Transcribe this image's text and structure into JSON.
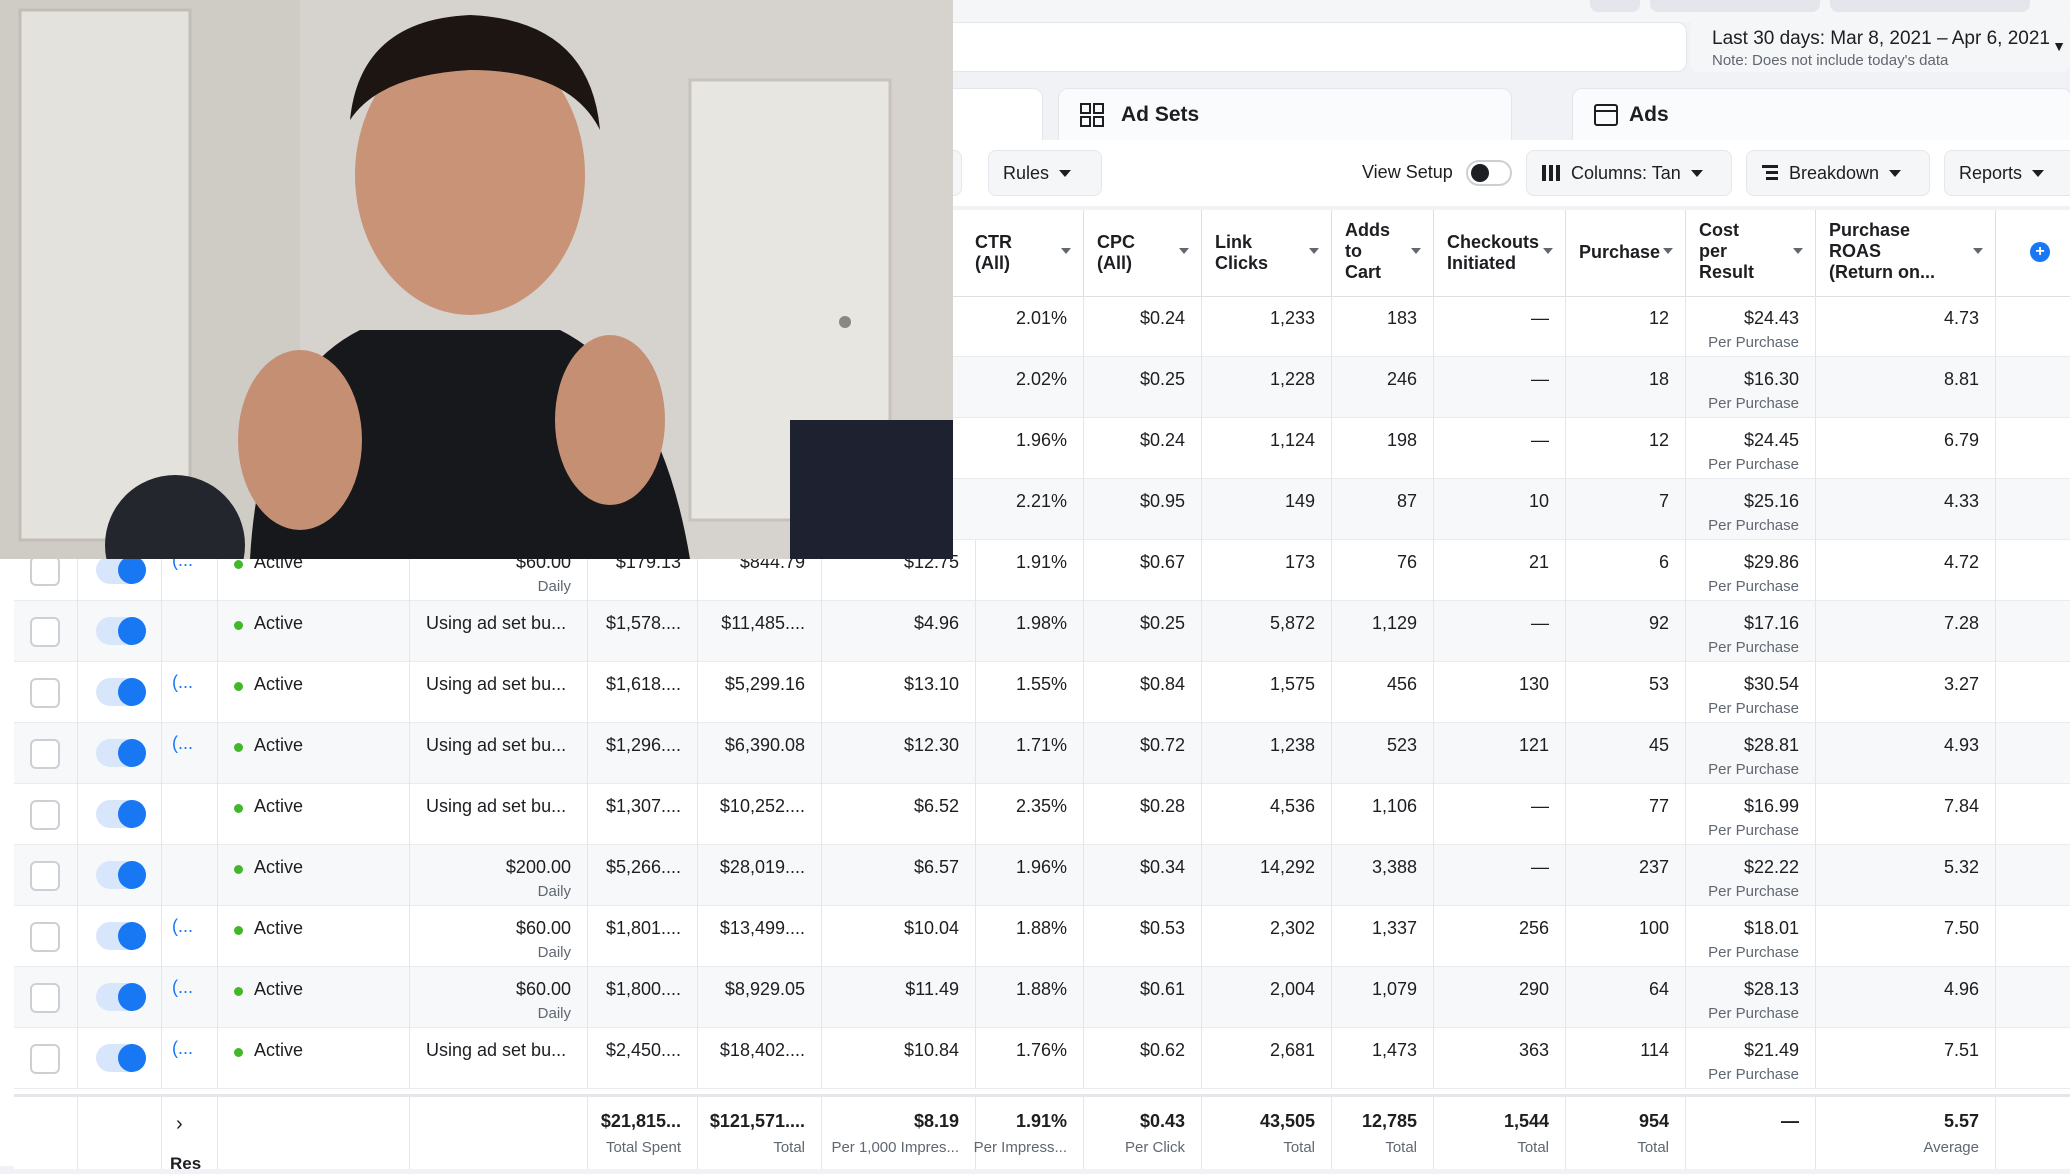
{
  "date_range": {
    "label": "Last 30 days: Mar 8, 2021 – Apr 6, 2021",
    "note": "Note: Does not include today's data"
  },
  "tabs": [
    {
      "label": "Ad Sets",
      "icon": "grid-icon"
    },
    {
      "label": "Ads",
      "icon": "ad-preview-icon"
    }
  ],
  "toolbar": {
    "rules_label": "Rules",
    "view_setup_label": "View Setup",
    "columns_label": "Columns: Tan",
    "breakdown_label": "Breakdown",
    "reports_label": "Reports"
  },
  "columns": [
    "CTR\n(All)",
    "CPC\n(All)",
    "Link\nClicks",
    "Adds\nto\nCart",
    "Checkouts\nInitiated",
    "Purchase",
    "Cost\nper\nResult",
    "Purchase\nROAS\n(Return on..."
  ],
  "top_rows": [
    {
      "ctr": "2.01%",
      "cpc": "$0.24",
      "clicks": "1,233",
      "atc": "183",
      "checkouts": "—",
      "purchases": "12",
      "cpr": "$24.43",
      "cpr_sub": "Per Purchase",
      "roas": "4.73"
    },
    {
      "ctr": "2.02%",
      "cpc": "$0.25",
      "clicks": "1,228",
      "atc": "246",
      "checkouts": "—",
      "purchases": "18",
      "cpr": "$16.30",
      "cpr_sub": "Per Purchase",
      "roas": "8.81"
    },
    {
      "ctr": "1.96%",
      "cpc": "$0.24",
      "clicks": "1,124",
      "atc": "198",
      "checkouts": "—",
      "purchases": "12",
      "cpr": "$24.45",
      "cpr_sub": "Per Purchase",
      "roas": "6.79"
    },
    {
      "ctr": "2.21%",
      "cpc": "$0.95",
      "clicks": "149",
      "atc": "87",
      "checkouts": "10",
      "purchases": "7",
      "cpr": "$25.16",
      "cpr_sub": "Per Purchase",
      "roas": "4.33"
    }
  ],
  "rows": [
    {
      "name": "(...",
      "status": "Active",
      "budget": "$60.00",
      "budget_sub": "Daily",
      "spent": "$179.13",
      "value": "$844.79",
      "cpm": "$12.75",
      "ctr": "1.91%",
      "cpc": "$0.67",
      "clicks": "173",
      "atc": "76",
      "checkouts": "21",
      "purchases": "6",
      "cpr": "$29.86",
      "cpr_sub": "Per Purchase",
      "roas": "4.72"
    },
    {
      "name": "",
      "status": "Active",
      "budget": "Using ad set bu...",
      "budget_sub": "",
      "spent": "$1,578....",
      "value": "$11,485....",
      "cpm": "$4.96",
      "ctr": "1.98%",
      "cpc": "$0.25",
      "clicks": "5,872",
      "atc": "1,129",
      "checkouts": "—",
      "purchases": "92",
      "cpr": "$17.16",
      "cpr_sub": "Per Purchase",
      "roas": "7.28"
    },
    {
      "name": "(...",
      "status": "Active",
      "budget": "Using ad set bu...",
      "budget_sub": "",
      "spent": "$1,618....",
      "value": "$5,299.16",
      "cpm": "$13.10",
      "ctr": "1.55%",
      "cpc": "$0.84",
      "clicks": "1,575",
      "atc": "456",
      "checkouts": "130",
      "purchases": "53",
      "cpr": "$30.54",
      "cpr_sub": "Per Purchase",
      "roas": "3.27"
    },
    {
      "name": "(...",
      "status": "Active",
      "budget": "Using ad set bu...",
      "budget_sub": "",
      "spent": "$1,296....",
      "value": "$6,390.08",
      "cpm": "$12.30",
      "ctr": "1.71%",
      "cpc": "$0.72",
      "clicks": "1,238",
      "atc": "523",
      "checkouts": "121",
      "purchases": "45",
      "cpr": "$28.81",
      "cpr_sub": "Per Purchase",
      "roas": "4.93"
    },
    {
      "name": "",
      "status": "Active",
      "budget": "Using ad set bu...",
      "budget_sub": "",
      "spent": "$1,307....",
      "value": "$10,252....",
      "cpm": "$6.52",
      "ctr": "2.35%",
      "cpc": "$0.28",
      "clicks": "4,536",
      "atc": "1,106",
      "checkouts": "—",
      "purchases": "77",
      "cpr": "$16.99",
      "cpr_sub": "Per Purchase",
      "roas": "7.84"
    },
    {
      "name": "",
      "status": "Active",
      "budget": "$200.00",
      "budget_sub": "Daily",
      "spent": "$5,266....",
      "value": "$28,019....",
      "cpm": "$6.57",
      "ctr": "1.96%",
      "cpc": "$0.34",
      "clicks": "14,292",
      "atc": "3,388",
      "checkouts": "—",
      "purchases": "237",
      "cpr": "$22.22",
      "cpr_sub": "Per Purchase",
      "roas": "5.32"
    },
    {
      "name": "(...",
      "status": "Active",
      "budget": "$60.00",
      "budget_sub": "Daily",
      "spent": "$1,801....",
      "value": "$13,499....",
      "cpm": "$10.04",
      "ctr": "1.88%",
      "cpc": "$0.53",
      "clicks": "2,302",
      "atc": "1,337",
      "checkouts": "256",
      "purchases": "100",
      "cpr": "$18.01",
      "cpr_sub": "Per Purchase",
      "roas": "7.50"
    },
    {
      "name": "(...",
      "status": "Active",
      "budget": "$60.00",
      "budget_sub": "Daily",
      "spent": "$1,800....",
      "value": "$8,929.05",
      "cpm": "$11.49",
      "ctr": "1.88%",
      "cpc": "$0.61",
      "clicks": "2,004",
      "atc": "1,079",
      "checkouts": "290",
      "purchases": "64",
      "cpr": "$28.13",
      "cpr_sub": "Per Purchase",
      "roas": "4.96"
    },
    {
      "name": "(...",
      "status": "Active",
      "budget": "Using ad set bu...",
      "budget_sub": "",
      "spent": "$2,450....",
      "value": "$18,402....",
      "cpm": "$10.84",
      "ctr": "1.76%",
      "cpc": "$0.62",
      "clicks": "2,681",
      "atc": "1,473",
      "checkouts": "363",
      "purchases": "114",
      "cpr": "$21.49",
      "cpr_sub": "Per Purchase",
      "roas": "7.51"
    }
  ],
  "totals": {
    "spent": "$21,815...",
    "spent_sub": "Total Spent",
    "value": "$121,571....",
    "value_sub": "Total",
    "cpm": "$8.19",
    "cpm_sub": "Per 1,000 Impres...",
    "ctr": "1.91%",
    "ctr_sub": "Per Impress...",
    "cpc": "$0.43",
    "cpc_sub": "Per Click",
    "clicks": "43,505",
    "clicks_sub": "Total",
    "atc": "12,785",
    "atc_sub": "Total",
    "checkouts": "1,544",
    "checkouts_sub": "Total",
    "purchases": "954",
    "purchases_sub": "Total",
    "cpr": "—",
    "roas": "5.57",
    "roas_sub": "Average",
    "results_label": "Res"
  },
  "colors": {
    "accent": "#1877f2",
    "active": "#42b72a"
  }
}
